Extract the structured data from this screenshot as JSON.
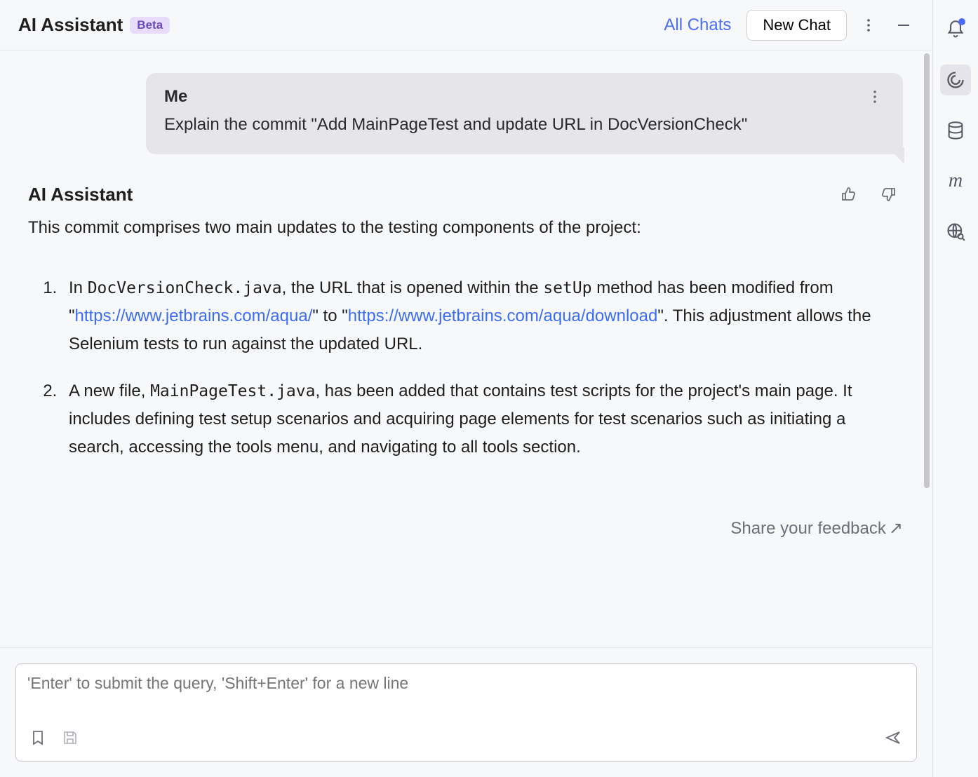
{
  "header": {
    "title": "AI Assistant",
    "badge": "Beta",
    "all_chats": "All Chats",
    "new_chat": "New Chat"
  },
  "user_message": {
    "sender": "Me",
    "text": "Explain the commit \"Add MainPageTest and update URL in DocVersionCheck\""
  },
  "assistant": {
    "name": "AI Assistant",
    "intro": "This commit comprises two main updates to the testing components of the project:",
    "item1": {
      "pre1": "In ",
      "code1": "DocVersionCheck.java",
      "mid1": ", the URL that is opened within the ",
      "code2": "setUp",
      "mid2": " method has been modified from \"",
      "link1": "https://www.jetbrains.com/aqua/",
      "mid3": "\" to \"",
      "link2": "https://www.jetbrains.com/aqua/download",
      "post": "\". This adjustment allows the Selenium tests to run against the updated URL."
    },
    "item2": {
      "pre1": "A new file, ",
      "code1": "MainPageTest.java",
      "post": ", has been added that contains test scripts for the project's main page. It includes defining test setup scenarios and acquiring page elements for test scenarios such as initiating a search, accessing the tools menu, and navigating to all tools section."
    }
  },
  "feedback_link": "Share your feedback",
  "input": {
    "placeholder": "'Enter' to submit the query, 'Shift+Enter' for a new line"
  }
}
